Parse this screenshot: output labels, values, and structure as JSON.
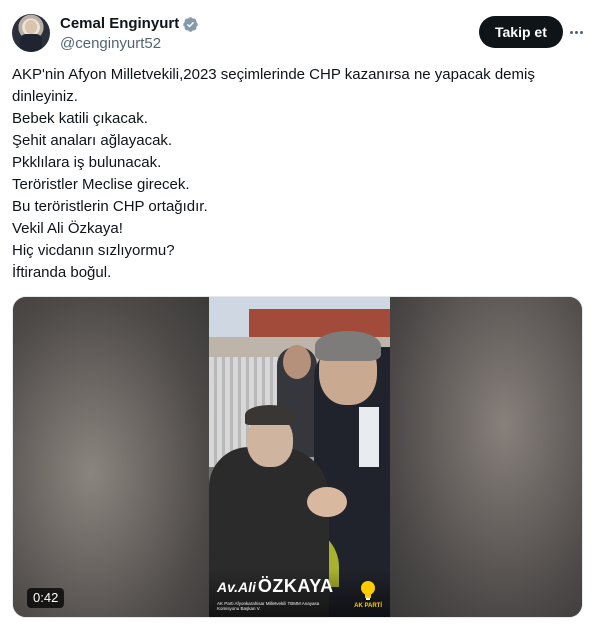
{
  "author": {
    "display_name": "Cemal Enginyurt",
    "handle": "@cenginyurt52",
    "verified": true,
    "avatar_icon": "profile-avatar"
  },
  "actions": {
    "follow_label": "Takip et",
    "more_icon": "ellipsis-icon"
  },
  "tweet": {
    "lines": [
      "AKP'nin Afyon Milletvekili,2023 seçimlerinde CHP kazanırsa ne yapacak demiş",
      "dinleyiniz.",
      "Bebek katili çıkacak.",
      "Şehit anaları ağlayacak.",
      "Pkklılara iş bulunacak.",
      "Teröristler Meclise girecek.",
      "Bu teröristlerin CHP ortağıdır.",
      "Vekil Ali Özkaya!",
      "Hiç vicdanın sızlıyormu?",
      "İftiranda boğul."
    ]
  },
  "media": {
    "type": "video",
    "duration": "0:42",
    "overlay": {
      "prefix": "Av.Ali",
      "name": "ÖZKAYA",
      "subtitle": "AK Parti Afyonkarahisar Milletvekili TBMM Anayasa Komisyonu Başkan V.",
      "party_label": "AK PARTİ"
    }
  },
  "colors": {
    "text": "#0f1419",
    "secondary": "#536471",
    "verified_blue": "#1d9bf0",
    "button_bg": "#0f1419"
  }
}
